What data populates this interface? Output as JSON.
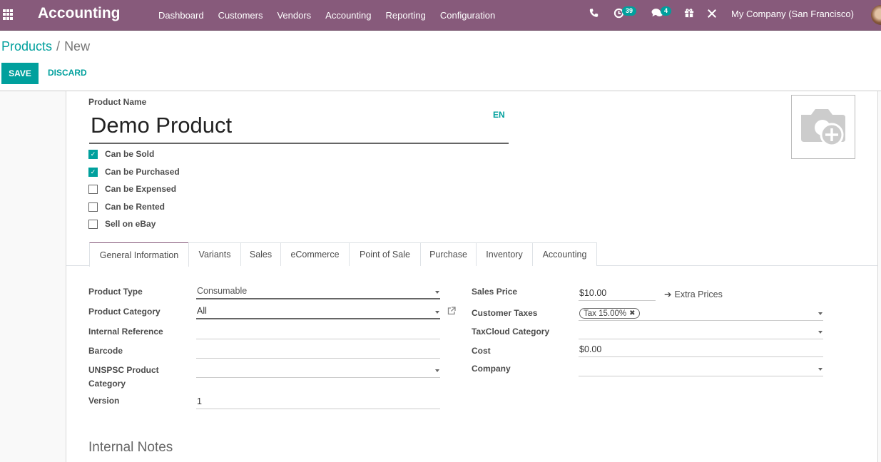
{
  "navbar": {
    "app_title": "Accounting",
    "menu": [
      "Dashboard",
      "Customers",
      "Vendors",
      "Accounting",
      "Reporting",
      "Configuration"
    ],
    "activity_count": "39",
    "message_count": "4",
    "company": "My Company (San Francisco)"
  },
  "breadcrumb": {
    "parent": "Products",
    "separator": "/",
    "current": "New"
  },
  "toolbar": {
    "save_label": "SAVE",
    "discard_label": "DISCARD"
  },
  "colors": {
    "brand": "#875a7b",
    "accent": "#00a09d"
  },
  "product": {
    "name_label": "Product Name",
    "name_value": "Demo Product",
    "lang": "EN",
    "options": [
      {
        "label": "Can be Sold",
        "checked": true
      },
      {
        "label": "Can be Purchased",
        "checked": true
      },
      {
        "label": "Can be Expensed",
        "checked": false
      },
      {
        "label": "Can be Rented",
        "checked": false
      },
      {
        "label": "Sell on eBay",
        "checked": false
      }
    ]
  },
  "tabs": [
    "General Information",
    "Variants",
    "Sales",
    "eCommerce",
    "Point of Sale",
    "Purchase",
    "Inventory",
    "Accounting"
  ],
  "active_tab": "General Information",
  "general": {
    "left": {
      "product_type": {
        "label": "Product Type",
        "value": "Consumable"
      },
      "product_category": {
        "label": "Product Category",
        "value": "All"
      },
      "internal_reference": {
        "label": "Internal Reference",
        "value": ""
      },
      "barcode": {
        "label": "Barcode",
        "value": ""
      },
      "unspsc_line1": "UNSPSC Product",
      "unspsc_line2": "Category",
      "unspsc_value": "",
      "version": {
        "label": "Version",
        "value": "1"
      }
    },
    "right": {
      "sales_price": {
        "label": "Sales Price",
        "value": "$10.00"
      },
      "extra_prices": "Extra Prices",
      "customer_taxes": {
        "label": "Customer Taxes",
        "tag": "Tax 15.00%"
      },
      "taxcloud_category": {
        "label": "TaxCloud Category",
        "value": ""
      },
      "cost": {
        "label": "Cost",
        "value": "$0.00"
      },
      "company": {
        "label": "Company",
        "value": ""
      }
    }
  },
  "internal_notes_title": "Internal Notes"
}
